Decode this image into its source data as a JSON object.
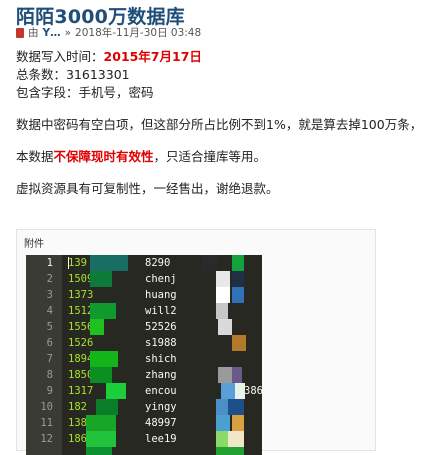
{
  "post": {
    "title": "陌陌3000万数据库",
    "author_prefix": "由",
    "author": "Y…",
    "separator": "»",
    "datetime": "2018年-11月-30日 03:48"
  },
  "content": {
    "write_time_label": "数据写入时间：",
    "write_time_value": "2015年7月17日",
    "total_count": "总条数：31613301",
    "fields": "包含字段：手机号，密码",
    "note_passwords": "数据中密码有空白项，但这部分所占比例不到1%，就是算去掉100万条，",
    "disclaimer_prefix": "本数据",
    "disclaimer_highlight": "不保障现时有效性",
    "disclaimer_suffix": "，只适合撞库等用。",
    "refund_policy": "虚拟资源具有可复制性，一经售出，谢绝退款。"
  },
  "attachment": {
    "label": "附件",
    "lines": [
      {
        "num": "1",
        "phone": "139",
        "user": "8290"
      },
      {
        "num": "2",
        "phone": "1509",
        "user": "chenj"
      },
      {
        "num": "3",
        "phone": "1373",
        "user": "huang"
      },
      {
        "num": "4",
        "phone": "1512",
        "user": "will2"
      },
      {
        "num": "5",
        "phone": "1556",
        "user": "52526"
      },
      {
        "num": "6",
        "phone": "1526",
        "user": "s1988"
      },
      {
        "num": "7",
        "phone": "1894",
        "user": "shich"
      },
      {
        "num": "8",
        "phone": "1850",
        "user": "zhang"
      },
      {
        "num": "9",
        "phone": "1317",
        "user": "encou"
      },
      {
        "num": "10",
        "phone": "182",
        "user": "yingy"
      },
      {
        "num": "11",
        "phone": "1389",
        "user": "48997"
      },
      {
        "num": "12",
        "phone": "1864",
        "user": "lee19"
      }
    ],
    "overflow_text": "386"
  },
  "colors": {
    "title": "#1f4e79",
    "highlight_red": "#e00000",
    "editor_bg": "#272822",
    "phone_green": "#a6e22e"
  }
}
